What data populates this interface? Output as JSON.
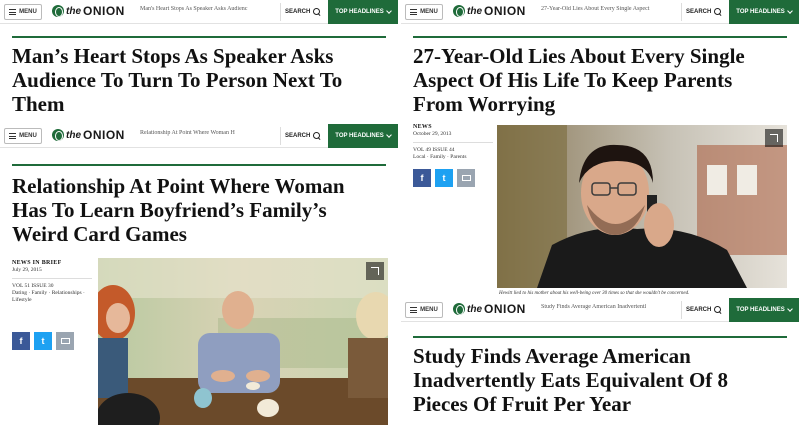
{
  "nav": {
    "menu_label": "MENU",
    "logo_the": "the",
    "logo_onion": "ONION",
    "search_label": "SEARCH",
    "top_headlines_label": "TOP HEADLINES"
  },
  "panels": [
    {
      "nav_article": "Man's Heart Stops As Speaker Asks Audienc",
      "headline": "Man’s Heart Stops As Speaker Asks Audience To Turn To Person Next To Them"
    },
    {
      "nav_article": "Relationship At Point Where Woman H",
      "headline": "Relationship At Point Where Woman Has To Learn Boyfriend’s Family’s Weird Card Games",
      "category": "NEWS IN BRIEF",
      "date": "July 29, 2015",
      "issue": "VOL 51 ISSUE 30",
      "tags": "Dating · Family · Relationships · Lifestyle"
    },
    {
      "nav_article": "27-Year-Old Lies About Every Single Aspect",
      "headline": "27-Year-Old Lies About Every Single Aspect Of His Life To Keep Parents From Worrying",
      "category": "NEWS",
      "date": "October 29, 2013",
      "issue": "VOL 49 ISSUE 44",
      "tags": "Local · Family · Parents",
      "caption": "Hewitt lied to his mother about his well-being over 30 times so that she wouldn't be concerned."
    },
    {
      "nav_article": "Study Finds Average American Inadvertentl",
      "headline": "Study Finds Average American Inadvertently Eats Equivalent Of 8 Pieces Of Fruit Per Year"
    }
  ],
  "share": {
    "facebook": "f",
    "twitter": "t"
  },
  "colors": {
    "brand_green": "#1f6b3a",
    "facebook": "#3b5998",
    "twitter": "#1da1f2"
  }
}
